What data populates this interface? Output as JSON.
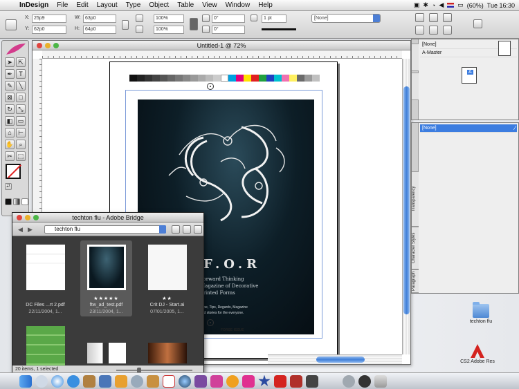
{
  "menubar": {
    "app": "InDesign",
    "items": [
      "File",
      "Edit",
      "Layout",
      "Type",
      "Object",
      "Table",
      "View",
      "Window",
      "Help"
    ],
    "battery": "(60%)",
    "clock": "Tue 16:30"
  },
  "controlbar": {
    "x_label": "X:",
    "x_value": "25p9",
    "y_label": "Y:",
    "y_value": "62p0",
    "w_label": "W:",
    "w_value": "63p0",
    "h_label": "H:",
    "h_value": "64p0",
    "scale_x": "100%",
    "scale_y": "100%",
    "rotate": "0°",
    "shear": "0°",
    "stroke_weight": "1 pt",
    "fill_dropdown": "[None]"
  },
  "document": {
    "title": "Untitled-1 @ 72%",
    "art_title": "F.O.R",
    "art_lines": [
      "Forward Thinking",
      "Magazine of Decorative",
      "Printed Forms"
    ],
    "art_sub": [
      "Type, Tips, Regards, Magazine",
      "and stories for the everyone."
    ],
    "footer": "FORSE ISSUE"
  },
  "pages_palette": {
    "rows": [
      "[None]",
      "A-Master"
    ],
    "page_label": "A"
  },
  "swatches_palette": {
    "selected": "[None]",
    "tabs": [
      "Transparency",
      "Character Styles",
      "Paragraph"
    ]
  },
  "bridge": {
    "title": "techton flu - Adobe Bridge",
    "path": "techton flu",
    "items": [
      {
        "name": "DC Files ...rt 2.pdf",
        "date": "22/11/2004, 1...",
        "stars": ""
      },
      {
        "name": "ftw_ad_test.pdf",
        "date": "23/11/2004, 1...",
        "stars": "★★★★★"
      },
      {
        "name": "Crit DJ - Start.ai",
        "date": "07/01/2005, 1...",
        "stars": "★★"
      }
    ],
    "status": "20 items, 1 selected"
  },
  "desktop": {
    "folder_label": "techton flu",
    "adobe_label": "CS2 Adobe Res"
  },
  "colors": {
    "accent": "#3c7de0",
    "scroll_thumb": "#3f7fd8",
    "art_bg": "#0d1e27"
  }
}
